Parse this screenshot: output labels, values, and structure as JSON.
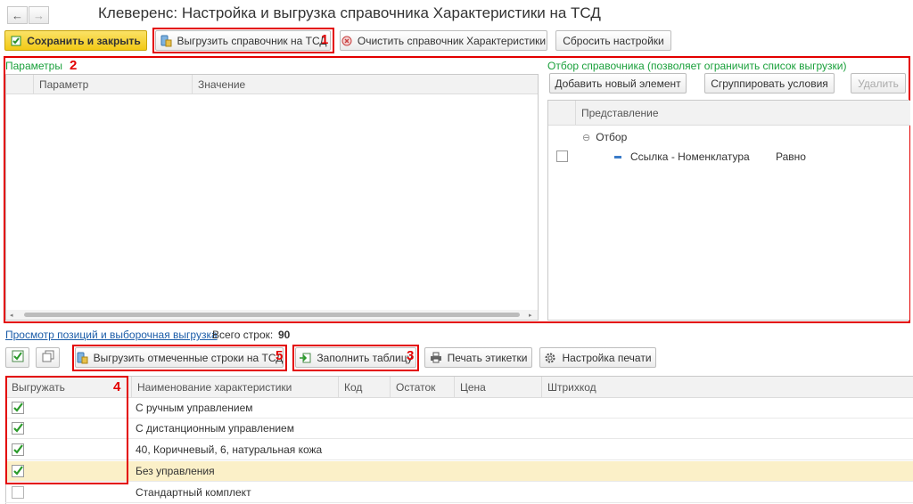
{
  "window": {
    "title": "Клеверенс: Настройка и выгрузка справочника Характеристики на ТСД"
  },
  "nav": {
    "back": "←",
    "forward": "→"
  },
  "toolbar": {
    "save_close": "Сохранить и закрыть",
    "upload_catalog": "Выгрузить справочник на ТСД",
    "clear_catalog": "Очистить справочник Характеристики",
    "reset_settings": "Сбросить настройки"
  },
  "params": {
    "label": "Параметры",
    "col_param": "Параметр",
    "col_value": "Значение"
  },
  "filter": {
    "label": "Отбор справочника (позволяет ограничить список выгрузки)",
    "add_button": "Добавить новый элемент",
    "group_button": "Сгруппировать условия",
    "delete_button": "Удалить",
    "col_repr": "Представление",
    "group_label": "Отбор",
    "item_label": "Ссылка - Номенклатура",
    "item_cond": "Равно"
  },
  "bottom": {
    "link": "Просмотр позиций и выборочная выгрузка",
    "total_label": "Всего строк:",
    "total_value": "90",
    "upload_marked": "Выгрузить отмеченные строки на ТСД",
    "fill_table": "Заполнить таблицу",
    "print_labels": "Печать этикетки",
    "print_settings": "Настройка печати"
  },
  "table": {
    "columns": [
      "Выгружать",
      "Наименование характеристики",
      "Код",
      "Остаток",
      "Цена",
      "Штрихкод"
    ],
    "rows": [
      {
        "checked": true,
        "name": "С ручным управлением"
      },
      {
        "checked": true,
        "name": "С дистанционным управлением"
      },
      {
        "checked": true,
        "name": "40, Коричневый, 6, натуральная кожа"
      },
      {
        "checked": true,
        "name": "Без управления"
      },
      {
        "checked": false,
        "name": "Стандартный комплект"
      }
    ]
  },
  "annotations": [
    "1",
    "2",
    "3",
    "4",
    "5"
  ],
  "colors": {
    "annotation": "#e30000",
    "green_label": "#1aa03b",
    "selected_row": "#fbf0c8",
    "save_button": "#f2c916"
  }
}
